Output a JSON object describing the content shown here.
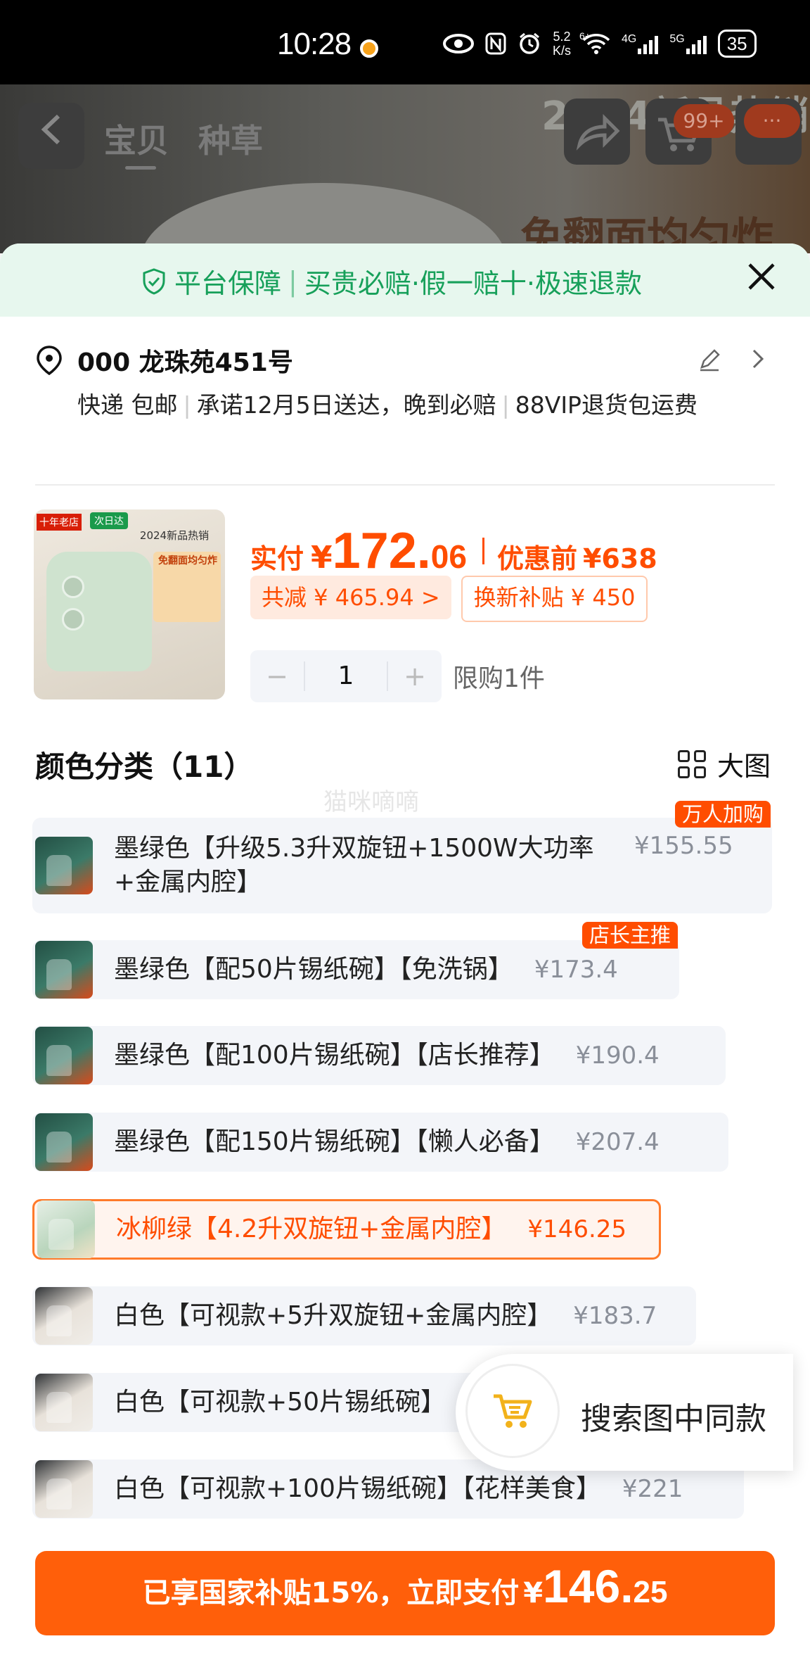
{
  "status_bar": {
    "time": "10:28",
    "net_speed_value": "5.2",
    "net_speed_unit": "K/s",
    "wifi_label": "6+",
    "cell1_label": "4G",
    "cell2_label": "5G",
    "battery": "35"
  },
  "header": {
    "tab_item": "宝贝",
    "tab_seed": "种草",
    "cart_badge": "99+",
    "more_badge": "···",
    "banner_top": "2024新品热销",
    "banner_text": "免翻面均匀炸"
  },
  "guarantee": {
    "title": "平台保障",
    "items": "买贵必赔·假一赔十·极速退款"
  },
  "address": {
    "name": "000 龙珠苑451号",
    "delivery": "快递 包邮",
    "promise": "承诺12月5日送达，晚到必赔",
    "vip": "88VIP退货包运费"
  },
  "product": {
    "thumb_tag1": "十年老店",
    "thumb_tag2": "次日达",
    "thumb_title": "2024新品热销",
    "thumb_promo": "免翻面均匀炸",
    "pay_label": "实付",
    "currency": "¥",
    "price_int": "172.",
    "price_dec": "06",
    "before_label": "优惠前",
    "before_price": "¥638",
    "discount_chip": "共减 ¥ 465.94 >",
    "subsidy_chip": "换新补贴 ¥ 450",
    "qty_minus": "−",
    "qty_value": "1",
    "qty_plus": "+",
    "limit": "限购1件"
  },
  "options_section": {
    "title": "颜色分类（11）",
    "big_view": "大图",
    "watermark": "猫咪嘀嘀"
  },
  "options": [
    {
      "name": "墨绿色【升级5.3升双旋钮+1500W大功率+金属内腔】",
      "price": "¥155.55",
      "flag": "万人加购"
    },
    {
      "name": "墨绿色【配50片锡纸碗】【免洗锅】",
      "price": "¥173.4",
      "flag": "店长主推"
    },
    {
      "name": "墨绿色【配100片锡纸碗】【店长推荐】",
      "price": "¥190.4"
    },
    {
      "name": "墨绿色【配150片锡纸碗】【懒人必备】",
      "price": "¥207.4"
    },
    {
      "name": "冰柳绿【4.2升双旋钮+金属内腔】",
      "price": "¥146.25"
    },
    {
      "name": "白色【可视款+5升双旋钮+金属内腔】",
      "price": "¥183.7"
    },
    {
      "name": "白色【可视款+50片锡纸碗】",
      "price": ""
    },
    {
      "name": "白色【可视款+100片锡纸碗】【花样美食】",
      "price": "¥221"
    }
  ],
  "float_search": {
    "label": "搜索图中同款"
  },
  "pay_button": {
    "text": "已享国家补贴15%，立即支付",
    "currency": "¥",
    "int": "146.",
    "dec": "25"
  },
  "colors": {
    "accent": "#ff4d00",
    "pay_button": "#ff5f0a",
    "guarantee_green": "#17a05a"
  }
}
